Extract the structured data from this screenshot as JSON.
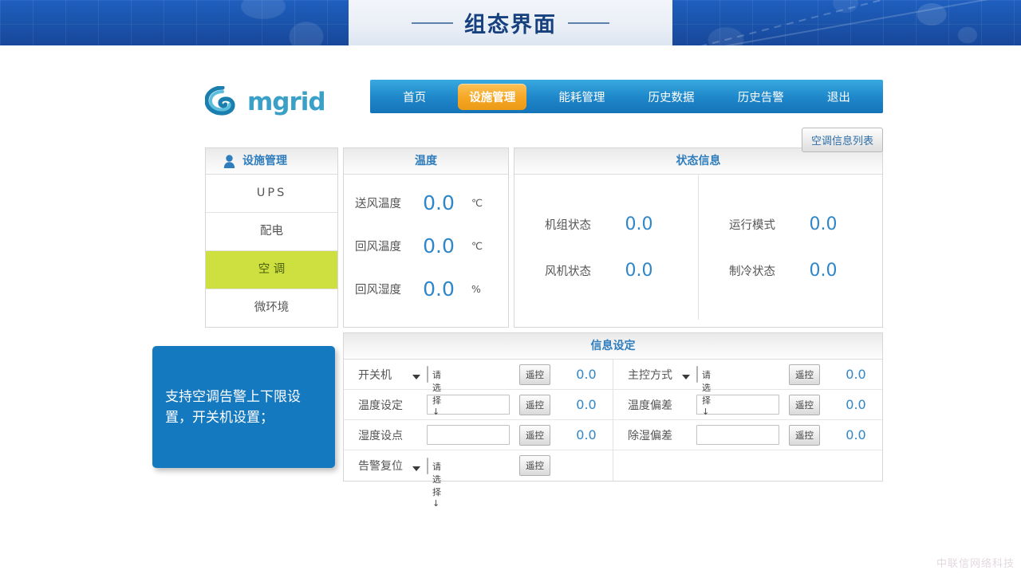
{
  "banner": {
    "title": "组态界面"
  },
  "brand": {
    "logo_icon": "spiral-swirl-icon",
    "name": "mgrid"
  },
  "nav": {
    "items": [
      {
        "label": "首页",
        "active": false
      },
      {
        "label": "设施管理",
        "active": true
      },
      {
        "label": "能耗管理",
        "active": false
      },
      {
        "label": "历史数据",
        "active": false
      },
      {
        "label": "历史告警",
        "active": false
      },
      {
        "label": "退出",
        "active": false
      }
    ]
  },
  "toolbar": {
    "list_button": "空调信息列表"
  },
  "sidebar": {
    "header": "设施管理",
    "header_icon": "user-icon",
    "items": [
      {
        "label": "UPS",
        "active": false
      },
      {
        "label": "配电",
        "active": false
      },
      {
        "label": "空 调",
        "active": true
      },
      {
        "label": "微环境",
        "active": false
      }
    ]
  },
  "temperature": {
    "header": "温度",
    "rows": [
      {
        "label": "送风温度",
        "value": "0.0",
        "unit": "℃"
      },
      {
        "label": "回风温度",
        "value": "0.0",
        "unit": "℃"
      },
      {
        "label": "回风湿度",
        "value": "0.0",
        "unit": "%"
      }
    ]
  },
  "status": {
    "header": "状态信息",
    "left": [
      {
        "label": "机组状态",
        "value": "0.0"
      },
      {
        "label": "风机状态",
        "value": "0.0"
      }
    ],
    "right": [
      {
        "label": "运行模式",
        "value": "0.0"
      },
      {
        "label": "制冷状态",
        "value": "0.0"
      }
    ]
  },
  "settings": {
    "header": "信息设定",
    "select_placeholder": "请选择↓",
    "control_button": "遥控",
    "left_rows": [
      {
        "label": "开关机",
        "control": "select",
        "input_value": "",
        "value": "0.0"
      },
      {
        "label": "温度设定",
        "control": "input",
        "input_value": "",
        "value": "0.0"
      },
      {
        "label": "湿度设点",
        "control": "input",
        "input_value": "",
        "value": "0.0"
      },
      {
        "label": "告警复位",
        "control": "select",
        "input_value": "",
        "value": ""
      }
    ],
    "right_rows": [
      {
        "label": "主控方式",
        "control": "select",
        "input_value": "",
        "value": "0.0"
      },
      {
        "label": "温度偏差",
        "control": "input",
        "input_value": "",
        "value": "0.0"
      },
      {
        "label": "除湿偏差",
        "control": "input",
        "input_value": "",
        "value": "0.0"
      },
      {
        "label": "",
        "control": "none",
        "input_value": "",
        "value": ""
      }
    ]
  },
  "callout": {
    "text": "支持空调告警上下限设置，开关机设置；"
  },
  "watermark": {
    "text": "中联信网络科技"
  },
  "colors": {
    "banner_blue": "#1b55ad",
    "nav_blue": "#1e86c9",
    "active_orange": "#f5a623",
    "active_green": "#cde03f",
    "value_blue": "#2f86c8",
    "callout_blue": "#1579bf",
    "logo_teal": "#3aa0c8"
  }
}
